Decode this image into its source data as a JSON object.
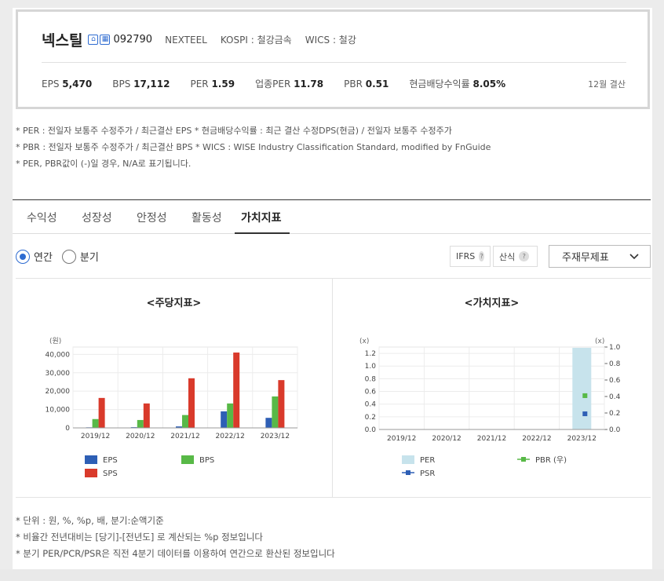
{
  "header": {
    "company_name": "넥스틸",
    "icon_1": "home-icon",
    "icon_2": "building-icon",
    "code": "092790",
    "english_name": "NEXTEEL",
    "market": "KOSPI : 철강금속",
    "wics": "WICS : 철강",
    "settlement": "12월 결산",
    "metrics": [
      {
        "label": "EPS",
        "value": "5,470"
      },
      {
        "label": "BPS",
        "value": "17,112"
      },
      {
        "label": "PER",
        "value": "1.59"
      },
      {
        "label": "업종PER",
        "value": "11.78"
      },
      {
        "label": "PBR",
        "value": "0.51"
      },
      {
        "label": "현금배당수익률",
        "value": "8.05%"
      }
    ]
  },
  "notes_top": [
    "* PER : 전일자 보통주 수정주가 / 최근결산 EPS * 현금배당수익률 : 최근 결산 수정DPS(현금) / 전일자 보통주 수정주가",
    "* PBR : 전일자 보통주 수정주가 / 최근결산 BPS * WICS : WISE Industry Classification Standard, modified by FnGuide",
    "* PER, PBR값이 (-)일 경우, N/A로 표기됩니다."
  ],
  "tabs": [
    {
      "label": "수익성"
    },
    {
      "label": "성장성"
    },
    {
      "label": "안정성"
    },
    {
      "label": "활동성"
    },
    {
      "label": "가치지표",
      "active": true
    }
  ],
  "period": {
    "annual": "연간",
    "quarter": "분기",
    "selected": "annual"
  },
  "options": {
    "ifrs": "IFRS",
    "calc": "산식",
    "help_icon": "?",
    "select_value": "주재무제표"
  },
  "colors": {
    "eps": "#2e5fb5",
    "bps": "#58b947",
    "sps": "#d93a2b",
    "per": "#c7e3ec",
    "pbr": "#58b947",
    "psr": "#2e5fb5"
  },
  "chart_data": [
    {
      "type": "bar",
      "title": "<주당지표>",
      "unit_label": "(원)",
      "categories": [
        "2019/12",
        "2020/12",
        "2021/12",
        "2022/12",
        "2023/12"
      ],
      "yticks": [
        "0",
        "10,000",
        "20,000",
        "30,000",
        "40,000"
      ],
      "ylim": [
        0,
        44000
      ],
      "series": [
        {
          "name": "EPS",
          "values": [
            300,
            400,
            800,
            9000,
            5470
          ]
        },
        {
          "name": "BPS",
          "values": [
            4800,
            4300,
            7000,
            13300,
            17112
          ]
        },
        {
          "name": "SPS",
          "values": [
            16300,
            13300,
            27000,
            41000,
            26000
          ]
        }
      ],
      "legend_placement": "bottom"
    },
    {
      "type": "bar",
      "title": "<가치지표>",
      "unit_label_left": "(x)",
      "unit_label_right": "(x)",
      "categories": [
        "2019/12",
        "2020/12",
        "2021/12",
        "2022/12",
        "2023/12"
      ],
      "yticks_left": [
        "0.0",
        "0.2",
        "0.4",
        "0.6",
        "0.8",
        "1.0",
        "1.2"
      ],
      "yticks_right": [
        "0.0",
        "0.2",
        "0.4",
        "0.6",
        "0.8",
        "1.0"
      ],
      "ylim_left": [
        0,
        1.3
      ],
      "ylim_right": [
        0,
        1.0
      ],
      "series": [
        {
          "name": "PER",
          "values": [
            null,
            null,
            null,
            null,
            1.59
          ]
        },
        {
          "name": "PBR (우)",
          "values": [
            null,
            null,
            null,
            null,
            0.41
          ]
        },
        {
          "name": "PSR",
          "values": [
            null,
            null,
            null,
            null,
            0.19
          ]
        }
      ],
      "legend_placement": "bottom"
    }
  ],
  "notes_bottom": [
    "* 단위 : 원, %, %p, 배, 분기:순액기준",
    "* 비율간 전년대비는 [당기]-[전년도] 로 계산되는 %p 정보입니다",
    "* 분기 PER/PCR/PSR은 직전 4분기 데이터를 이용하여 연간으로 환산된 정보입니다"
  ]
}
